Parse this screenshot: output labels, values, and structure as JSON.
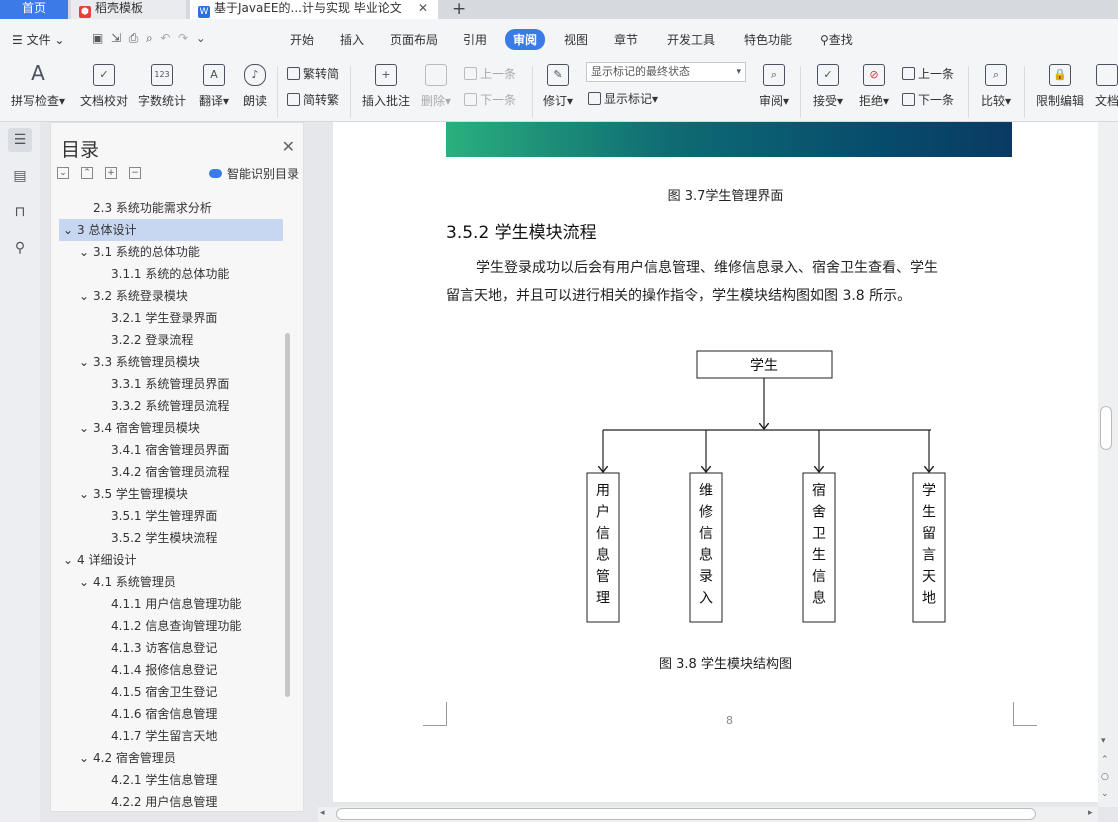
{
  "tabs": {
    "home": "首页",
    "daoke": "稻壳模板",
    "doc": "基于JavaEE的...计与实现 毕业论文"
  },
  "menu": {
    "file": "文件",
    "items": [
      "开始",
      "插入",
      "页面布局",
      "引用",
      "审阅",
      "视图",
      "章节",
      "开发工具",
      "特色功能"
    ],
    "active": "审阅",
    "search": "查找"
  },
  "ribbon": {
    "spell": "拼写检查",
    "doccheck": "文档校对",
    "wordcount": "字数统计",
    "translate": "翻译",
    "read": "朗读",
    "trad": "繁转简",
    "simp": "简转繁",
    "insert_comment": "插入批注",
    "delete": "删除",
    "prev1": "上一条",
    "next1": "下一条",
    "track": "修订",
    "markup_state": "显示标记的最终状态",
    "show_markup": "显示标记",
    "review": "审阅",
    "accept": "接受",
    "reject": "拒绝",
    "prev2": "上一条",
    "next2": "下一条",
    "compare": "比较",
    "restrict": "限制编辑",
    "docright": "文档"
  },
  "nav": {
    "title": "目录",
    "smart": "智能识别目录",
    "items": [
      {
        "text": "2.3  系统功能需求分析",
        "level": 1,
        "arrow": ""
      },
      {
        "text": "3  总体设计",
        "level": 0,
        "arrow": "⌄"
      },
      {
        "text": "3.1  系统的总体功能",
        "level": 1,
        "arrow": "⌄"
      },
      {
        "text": "3.1.1  系统的总体功能",
        "level": 2,
        "arrow": ""
      },
      {
        "text": "3.2  系统登录模块",
        "level": 1,
        "arrow": "⌄"
      },
      {
        "text": "3.2.1  学生登录界面",
        "level": 2,
        "arrow": ""
      },
      {
        "text": "3.2.2  登录流程",
        "level": 2,
        "arrow": ""
      },
      {
        "text": "3.3  系统管理员模块",
        "level": 1,
        "arrow": "⌄"
      },
      {
        "text": "3.3.1  系统管理员界面",
        "level": 2,
        "arrow": ""
      },
      {
        "text": "3.3.2  系统管理员流程",
        "level": 2,
        "arrow": ""
      },
      {
        "text": "3.4  宿舍管理员模块",
        "level": 1,
        "arrow": "⌄"
      },
      {
        "text": "3.4.1  宿舍管理员界面",
        "level": 2,
        "arrow": ""
      },
      {
        "text": "3.4.2  宿舍管理员流程",
        "level": 2,
        "arrow": ""
      },
      {
        "text": "3.5  学生管理模块",
        "level": 1,
        "arrow": "⌄"
      },
      {
        "text": "3.5.1  学生管理界面",
        "level": 2,
        "arrow": ""
      },
      {
        "text": "3.5.2  学生模块流程",
        "level": 2,
        "arrow": ""
      },
      {
        "text": "4  详细设计",
        "level": 0,
        "arrow": "⌄"
      },
      {
        "text": "4.1  系统管理员",
        "level": 1,
        "arrow": "⌄"
      },
      {
        "text": "4.1.1  用户信息管理功能",
        "level": 2,
        "arrow": ""
      },
      {
        "text": "4.1.2  信息查询管理功能",
        "level": 2,
        "arrow": ""
      },
      {
        "text": "4.1.3  访客信息登记",
        "level": 2,
        "arrow": ""
      },
      {
        "text": "4.1.4  报修信息登记",
        "level": 2,
        "arrow": ""
      },
      {
        "text": "4.1.5  宿舍卫生登记",
        "level": 2,
        "arrow": ""
      },
      {
        "text": "4.1.6  宿舍信息管理",
        "level": 2,
        "arrow": ""
      },
      {
        "text": "4.1.7  学生留言天地",
        "level": 2,
        "arrow": ""
      },
      {
        "text": "4.2  宿舍管理员",
        "level": 1,
        "arrow": "⌄"
      },
      {
        "text": "4.2.1  学生信息管理",
        "level": 2,
        "arrow": ""
      },
      {
        "text": "4.2.2  用户信息管理",
        "level": 2,
        "arrow": ""
      }
    ],
    "selected_index": 1
  },
  "doc": {
    "caption_37": "图 3.7学生管理界面",
    "heading": "3.5.2  学生模块流程",
    "para1": "学生登录成功以后会有用户信息管理、维修信息录入、宿舍卫生查看、学生",
    "para2": "留言天地，并且可以进行相关的操作指令，学生模块结构图如图 3.8 所示。",
    "diagram": {
      "root": "学生",
      "children": [
        "用户信息管理",
        "维修信息录入",
        "宿舍卫生信息",
        "学生留言天地"
      ]
    },
    "caption_38": "图 3.8 学生模块结构图",
    "page_number": "8"
  }
}
